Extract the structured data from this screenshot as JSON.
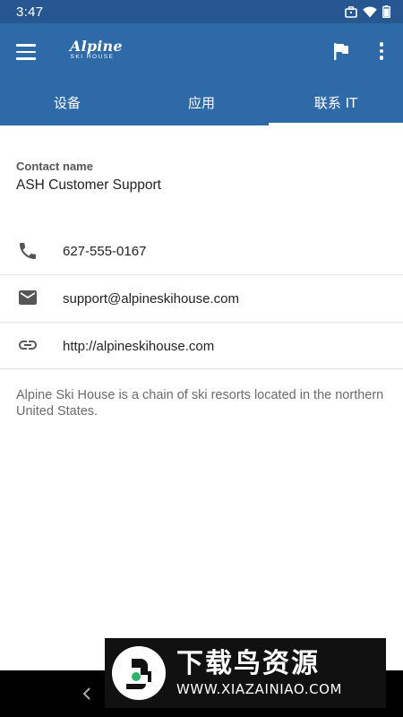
{
  "status_bar": {
    "time": "3:47"
  },
  "app_bar": {
    "logo_main": "Alpine",
    "logo_sub": "SKI HOUSE"
  },
  "tabs": [
    {
      "label": "设备",
      "active": false
    },
    {
      "label": "应用",
      "active": false
    },
    {
      "label": "联系 IT",
      "active": true
    }
  ],
  "contact": {
    "label": "Contact name",
    "name": "ASH Customer Support"
  },
  "rows": [
    {
      "icon": "phone-icon",
      "value": "627-555-0167"
    },
    {
      "icon": "email-icon",
      "value": "support@alpineskihouse.com"
    },
    {
      "icon": "link-icon",
      "value": "http://alpineskihouse.com"
    }
  ],
  "description": "Alpine Ski House is a chain of ski resorts located in the northern United States.",
  "watermark": {
    "title": "下载鸟资源",
    "url": "WWW.XIAZAINIAO.COM"
  },
  "colors": {
    "app_bar": "#2f6aa8",
    "status_bar": "#275791"
  }
}
